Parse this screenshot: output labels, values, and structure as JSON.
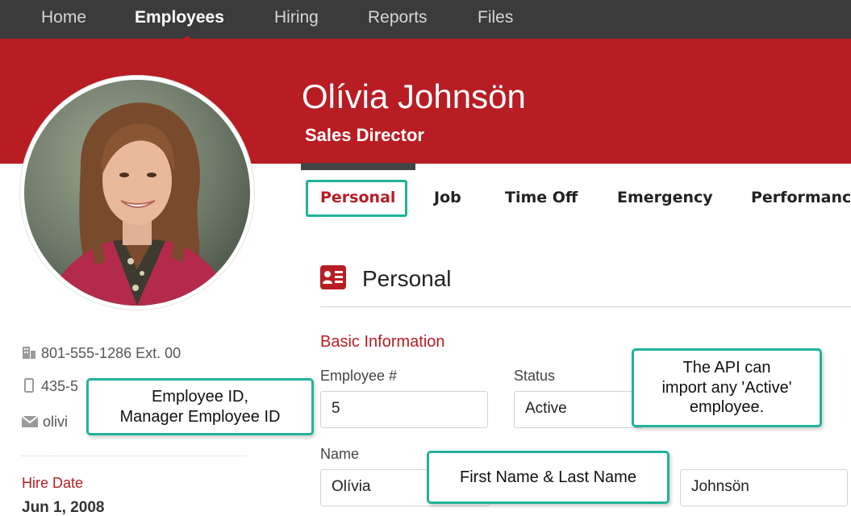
{
  "nav": {
    "items": [
      "Home",
      "Employees",
      "Hiring",
      "Reports",
      "Files"
    ],
    "active": "Employees"
  },
  "employee": {
    "name": "Olívia Johnsön",
    "title": "Sales Director"
  },
  "tabs": [
    "Personal",
    "Job",
    "Time Off",
    "Emergency",
    "Performanc"
  ],
  "active_tab": "Personal",
  "section": {
    "title": "Personal",
    "icon": "id-card-icon"
  },
  "basic_info": {
    "header": "Basic Information",
    "employee_number": {
      "label": "Employee #",
      "value": "5"
    },
    "status": {
      "label": "Status",
      "value": "Active"
    },
    "name": {
      "label": "Name",
      "first": "Olívia",
      "last": "Johnsön"
    }
  },
  "contact": {
    "work_phone": "801-555-1286 Ext. 00",
    "mobile_phone_partial": "435-5",
    "email_partial": "olivi"
  },
  "hire": {
    "label": "Hire Date",
    "value": "Jun 1, 2008"
  },
  "callouts": {
    "employee_id": [
      "Employee ID,",
      "Manager Employee ID"
    ],
    "api_active": [
      "The API can",
      "import any 'Active'",
      "employee."
    ],
    "name": "First Name & Last Name"
  },
  "colors": {
    "brand_red": "#b81d23",
    "nav_dark": "#3b3b3b",
    "callout_teal": "#22b39a"
  }
}
